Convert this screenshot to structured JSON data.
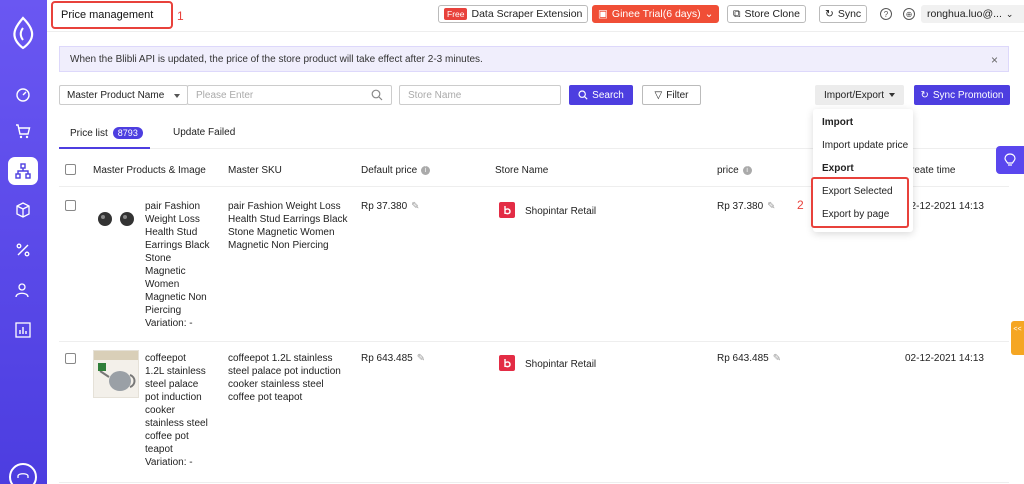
{
  "colors": {
    "primary": "#4d3ee0",
    "sidebar": "#5a47ee",
    "annotation": "#e8413b",
    "ginee": "#f04e36"
  },
  "header": {
    "page_title": "Price management",
    "annotation_1": "1",
    "free_tag": "Free",
    "scraper_label": "Data Scraper Extension",
    "ginee_label": "Ginee Trial(6 days)",
    "store_clone_label": "Store Clone",
    "sync_label": "Sync",
    "help_icon": "?",
    "user_label": "ronghua.luo@..."
  },
  "notice": {
    "text": "When the Blibli API is updated, the price of the store product will take effect after 2-3 minutes.",
    "close": "×"
  },
  "filters": {
    "field_select": "Master Product Name",
    "search_placeholder": "Please Enter",
    "store_placeholder": "Store Name",
    "search_button": "Search",
    "filter_button": "Filter",
    "import_export": "Import/Export",
    "sync_promotion": "Sync Promotion"
  },
  "tabs": {
    "price_list": "Price list",
    "price_list_count": "8793",
    "update_failed": "Update Failed"
  },
  "table": {
    "headers": {
      "product": "Master Products & Image",
      "sku": "Master SKU",
      "default_price": "Default price",
      "store_name": "Store Name",
      "price": "price",
      "create_time": "reate time"
    },
    "rows": [
      {
        "product_lines": [
          "pair Fashion",
          "Weight Loss",
          "Health Stud",
          "Earrings Black",
          "Stone",
          "Magnetic",
          "Women",
          "Magnetic Non",
          "Piercing",
          "Variation: -"
        ],
        "sku_lines": [
          "pair Fashion Weight Loss",
          "Health Stud Earrings Black",
          "Stone Magnetic Women",
          "Magnetic Non Piercing"
        ],
        "default_price": "Rp 37.380",
        "store": "Shopintar Retail",
        "price": "Rp 37.380",
        "time": "02-12-2021 14:13"
      },
      {
        "product_lines": [
          "coffeepot",
          "1.2L stainless",
          "steel palace",
          "pot induction",
          "cooker",
          "stainless steel",
          "coffee pot",
          "teapot",
          "Variation: -"
        ],
        "sku_lines": [
          "coffeepot 1.2L stainless",
          "steel palace pot induction",
          "cooker stainless steel",
          "coffee pot teapot"
        ],
        "default_price": "Rp 643.485",
        "store": "Shopintar Retail",
        "price": "Rp 643.485",
        "time": "02-12-2021 14:13"
      }
    ]
  },
  "dropdown": {
    "import_head": "Import",
    "import_update": "Import update price",
    "export_head": "Export",
    "export_selected": "Export Selected",
    "export_by_page": "Export by page",
    "annotation_2": "2"
  },
  "side_tab_text": "<<"
}
